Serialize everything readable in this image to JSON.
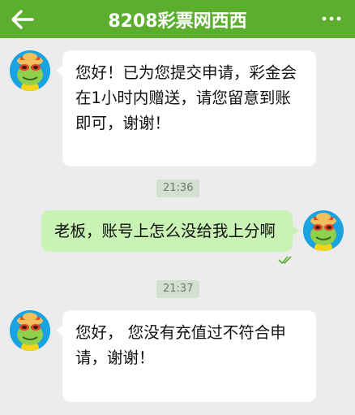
{
  "header": {
    "title": "8208彩票网西西",
    "back_icon": "arrow-left-icon",
    "more_icon": "more-dots-icon",
    "color": "#5cae2e"
  },
  "messages": [
    {
      "direction": "incoming",
      "text": "您好！已为您提交申请，彩金会在1小时内赠送，请您留意到账即可，谢谢！"
    },
    {
      "direction": "outgoing",
      "time": "21:36",
      "text": "老板，账号上怎么没给我上分啊",
      "status": "read-double-check-icon"
    },
    {
      "direction": "incoming",
      "time": "21:37",
      "text": "您好， 您没有充值过不符合申请，谢谢！"
    }
  ],
  "colors": {
    "background": "#ececec",
    "incoming_bubble": "#ffffff",
    "outgoing_bubble": "#c9f2b5",
    "time_chip": "#d3dfd0"
  }
}
